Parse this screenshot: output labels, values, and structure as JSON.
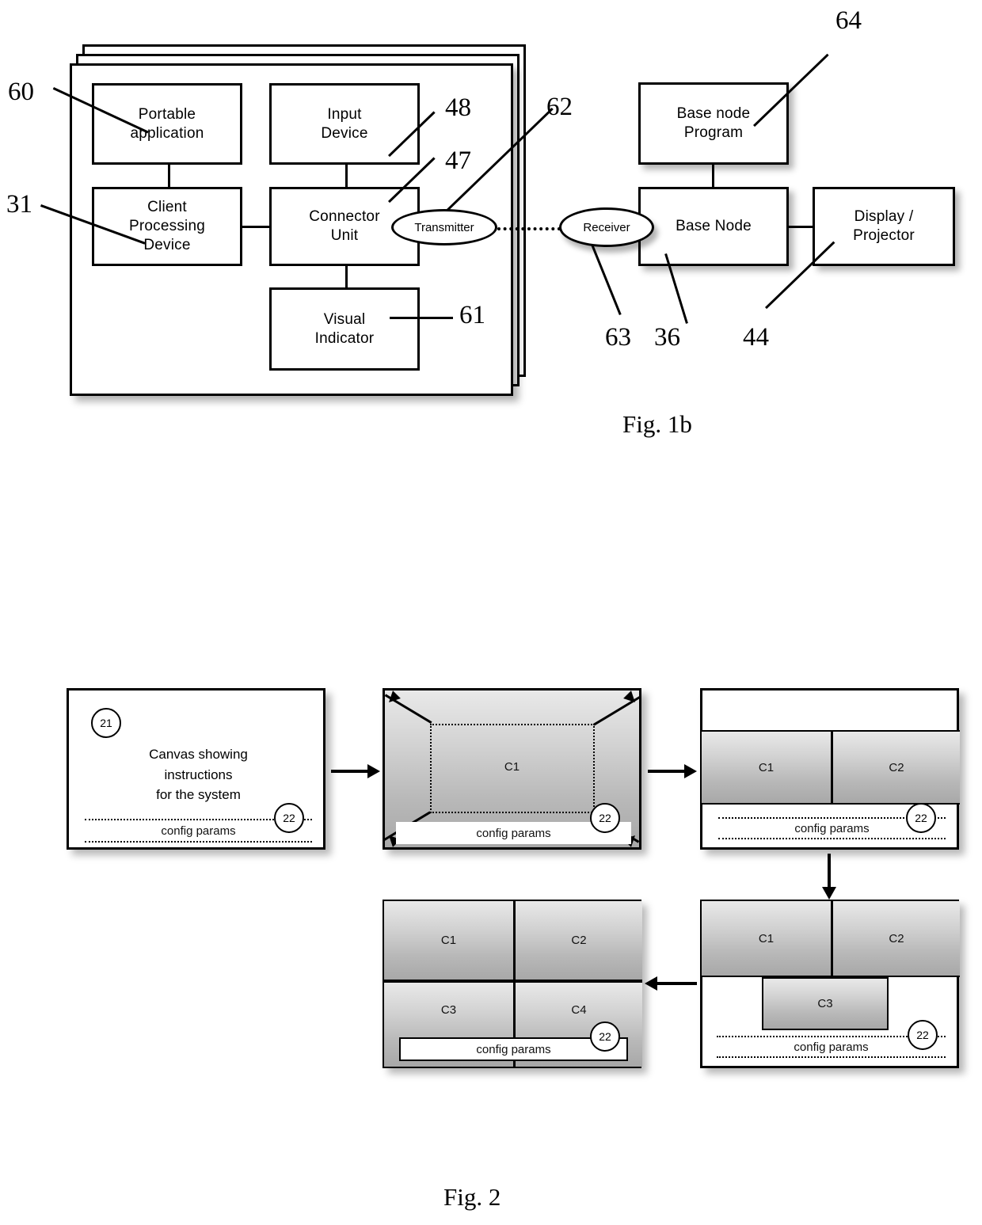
{
  "figure1b": {
    "caption": "Fig. 1b",
    "client_blocks": [
      {
        "id": "portable-application",
        "label": "Portable\napplication"
      },
      {
        "id": "input-device",
        "label": "Input\nDevice"
      },
      {
        "id": "client-processing-device",
        "label": "Client\nProcessing\nDevice"
      },
      {
        "id": "connector-unit",
        "label": "Connector\nUnit"
      },
      {
        "id": "visual-indicator",
        "label": "Visual\nIndicator"
      }
    ],
    "transmitter_label": "Transmitter",
    "receiver_label": "Receiver",
    "base_blocks": [
      {
        "id": "base-node-program",
        "label": "Base node\nProgram"
      },
      {
        "id": "base-node",
        "label": "Base Node"
      },
      {
        "id": "display-projector",
        "label": "Display /\nProjector"
      }
    ],
    "reference_numbers": {
      "portable_application": "60",
      "client_processing_device": "31",
      "input_device": "48",
      "connector_unit": "47",
      "transmitter": "62",
      "visual_indicator": "61",
      "base_node_program": "64",
      "receiver": "63",
      "base_node": "36",
      "display_projector": "44"
    }
  },
  "figure2": {
    "caption": "Fig. 2",
    "config_label": "config params",
    "canvas_marker": "21",
    "config_marker": "22",
    "panels": [
      {
        "id": "panel-initial-canvas",
        "canvas_text": "Canvas showing\ninstructions\nfor the system",
        "cells": []
      },
      {
        "id": "panel-single-client",
        "canvas_text": "",
        "cells": [
          "C1"
        ]
      },
      {
        "id": "panel-two-clients-banded",
        "canvas_text": "",
        "cells": [
          "C1",
          "C2"
        ]
      },
      {
        "id": "panel-three-clients",
        "canvas_text": "",
        "cells": [
          "C1",
          "C2",
          "C3"
        ]
      },
      {
        "id": "panel-four-clients",
        "canvas_text": "",
        "cells": [
          "C1",
          "C2",
          "C3",
          "C4"
        ]
      }
    ]
  }
}
